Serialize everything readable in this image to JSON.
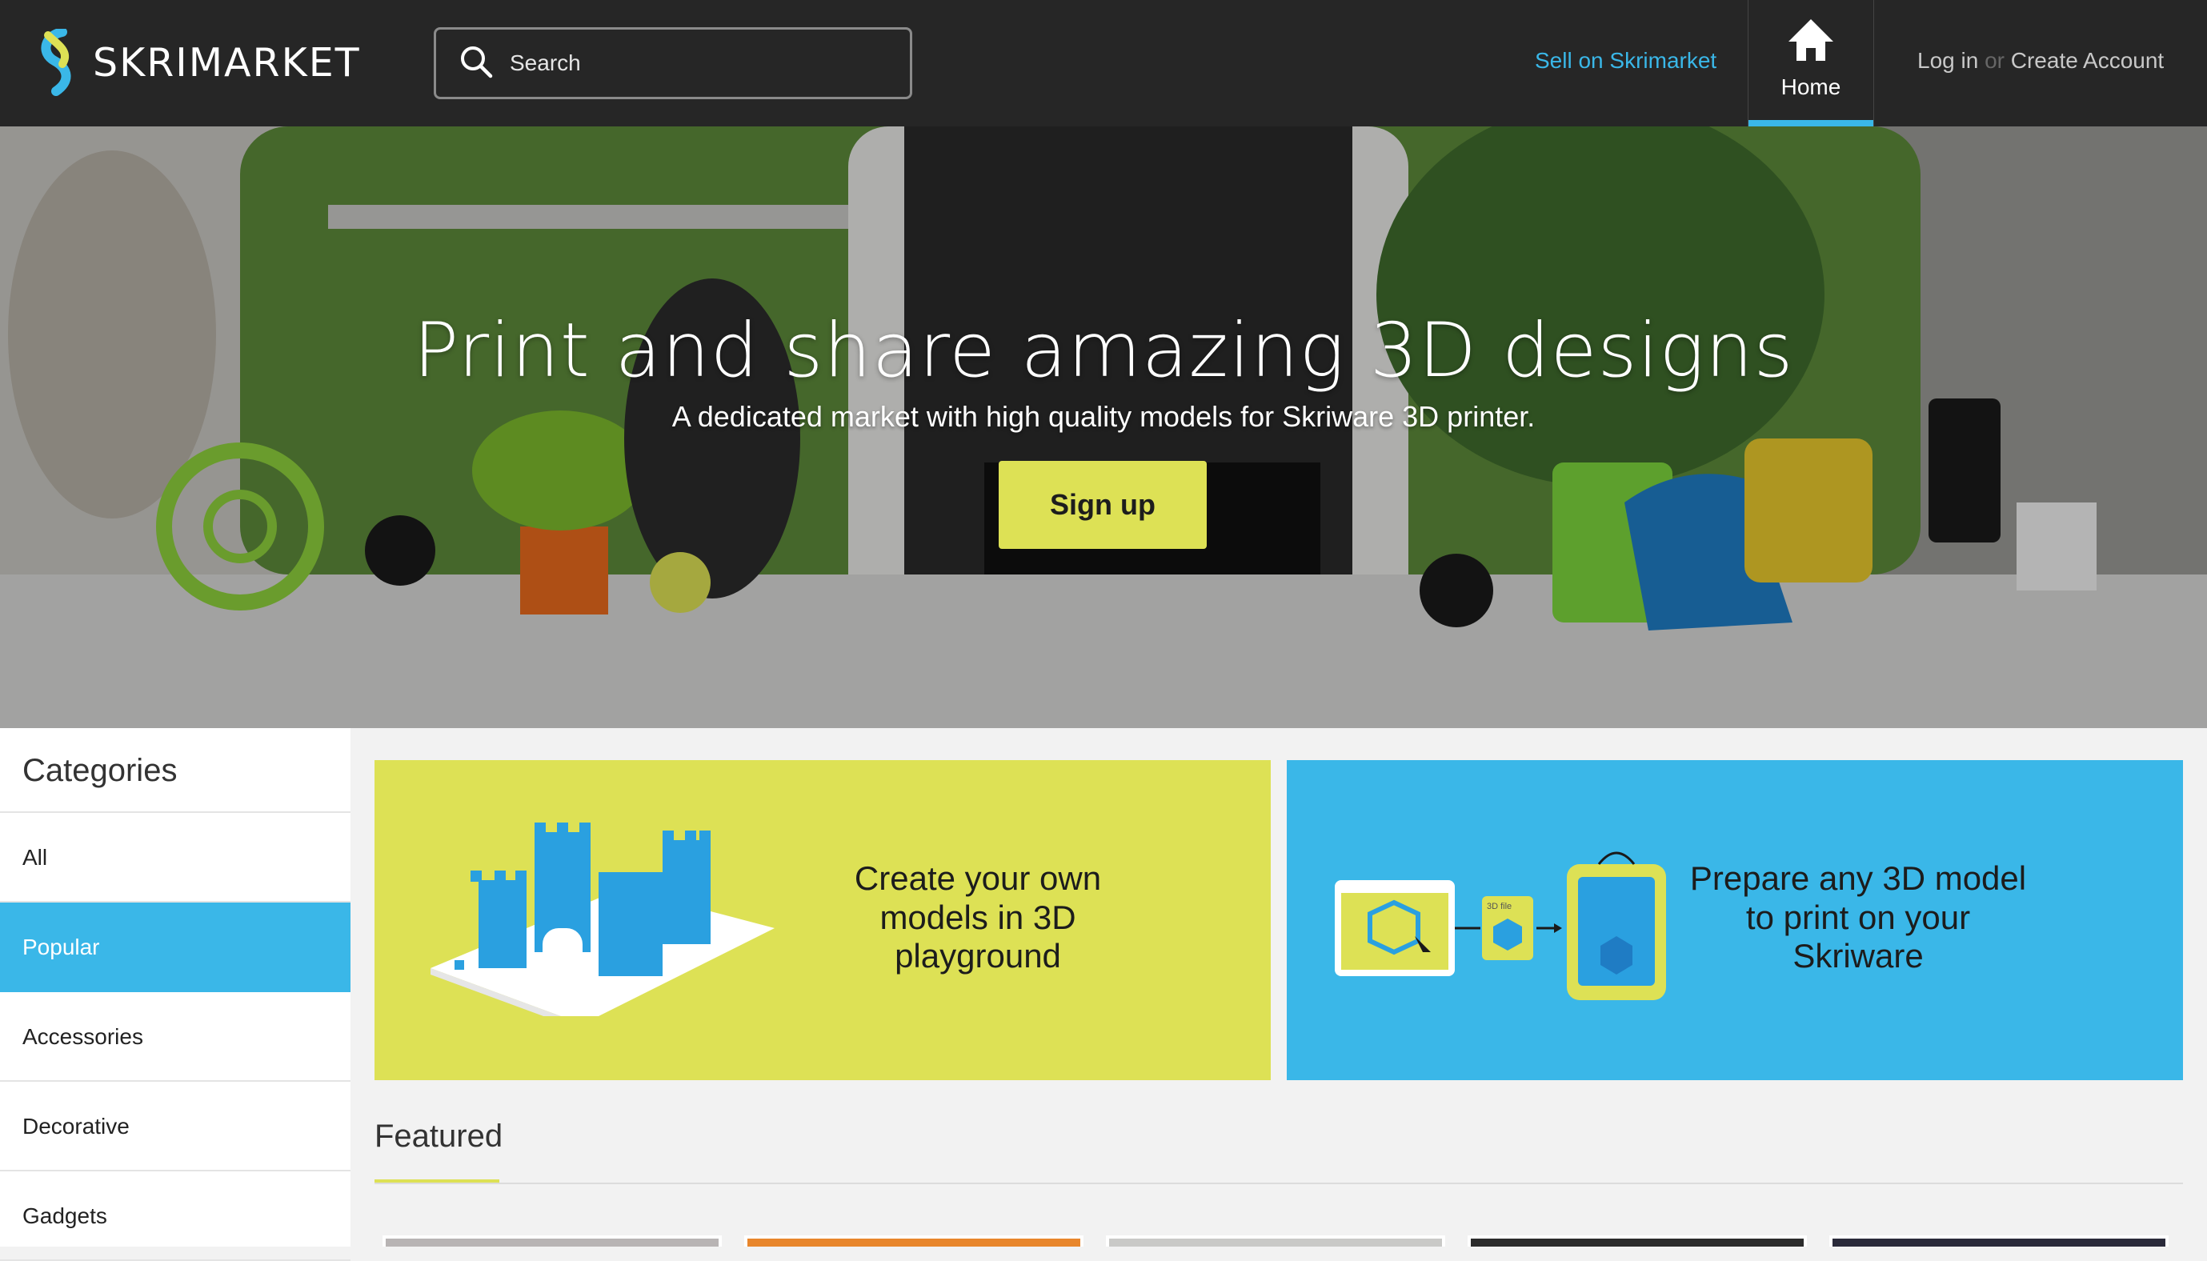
{
  "header": {
    "brand": "SKRIMARKET",
    "search_placeholder": "Search",
    "sell_link": "Sell on Skrimarket",
    "home_label": "Home",
    "login_label": "Log in",
    "or_label": "or",
    "create_account_label": "Create Account"
  },
  "hero": {
    "title": "Print and share amazing 3D designs",
    "subtitle": "A dedicated market with high quality models for Skriware 3D printer.",
    "cta_label": "Sign up"
  },
  "sidebar": {
    "title": "Categories",
    "items": [
      {
        "label": "All",
        "active": false
      },
      {
        "label": "Popular",
        "active": true
      },
      {
        "label": "Accessories",
        "active": false
      },
      {
        "label": "Decorative",
        "active": false
      },
      {
        "label": "Gadgets",
        "active": false
      }
    ]
  },
  "promos": {
    "playground": {
      "line1": "Create your own",
      "line2": "models in 3D",
      "line3": "playground"
    },
    "prepare": {
      "line1": "Prepare any 3D model",
      "line2": "to print on your",
      "line3": "Skriware",
      "file_tag": "3D file"
    }
  },
  "featured": {
    "title": "Featured"
  },
  "colors": {
    "accent_blue": "#3ab7e8",
    "accent_yellow": "#dde155",
    "header_bg": "#262626"
  },
  "icons": {
    "search": "search-icon",
    "home": "home-icon",
    "logo": "skrimarket-logo-icon"
  }
}
